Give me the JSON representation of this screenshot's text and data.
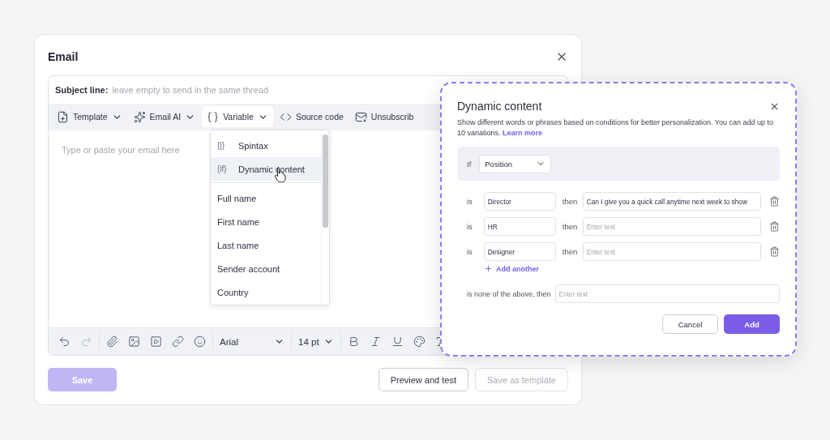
{
  "email_card": {
    "title": "Email",
    "subject": {
      "label": "Subject line:",
      "placeholder": "leave empty to send in the same thread"
    },
    "toolbar": [
      {
        "label": "Template",
        "selected": false
      },
      {
        "label": "Email AI",
        "selected": false
      },
      {
        "label": "Variable",
        "selected": true
      },
      {
        "label": "Source code",
        "selected": false
      },
      {
        "label": "Unsubscrib",
        "selected": false
      }
    ],
    "body": {
      "placeholder": "Type or paste your email here"
    },
    "format_bar": {
      "tools": [
        {
          "disabled": false
        },
        {
          "disabled": true
        },
        {
          "disabled": false
        },
        {
          "disabled": false
        },
        {
          "disabled": false
        },
        {
          "disabled": false
        },
        {
          "disabled": false
        }
      ],
      "font": "Arial",
      "size": "14 pt"
    },
    "buttons": [
      {
        "label": "Save",
        "kind": "primary",
        "disabled": true
      },
      {
        "label": "Preview and test",
        "kind": "outline",
        "disabled": false
      },
      {
        "label": "Save as template",
        "kind": "outline",
        "disabled": true
      }
    ]
  },
  "variable_menu": {
    "special": [
      {
        "glyph": "{|}",
        "label": "Spintax",
        "selected": false
      },
      {
        "glyph": "{if}",
        "label": "Dynamic content",
        "selected": true
      }
    ],
    "items": [
      "Full name",
      "First name",
      "Last name",
      "Sender account",
      "Country"
    ]
  },
  "dynamic_dialog": {
    "title": "Dynamic content",
    "description": "Show different words or phrases based on conditions for better personalization. You can add up to 10 variations.",
    "link": "Learn more",
    "if_label": "If",
    "field": "Position",
    "conditions": [
      {
        "is": "is",
        "value": "Director",
        "then": "then",
        "text": "Can I give you a quick call anytime next week to show"
      },
      {
        "is": "is",
        "value": "HR",
        "then": "then",
        "placeholder": "Enter text"
      },
      {
        "is": "is",
        "value": "Designer",
        "then": "then",
        "placeholder": "Enter text"
      }
    ],
    "add_another": "Add another",
    "fallback": {
      "label": "is none of the above, then",
      "placeholder": "Enter text"
    },
    "buttons": [
      {
        "label": "Cancel",
        "kind": "outline"
      },
      {
        "label": "Add",
        "kind": "primary"
      }
    ]
  }
}
